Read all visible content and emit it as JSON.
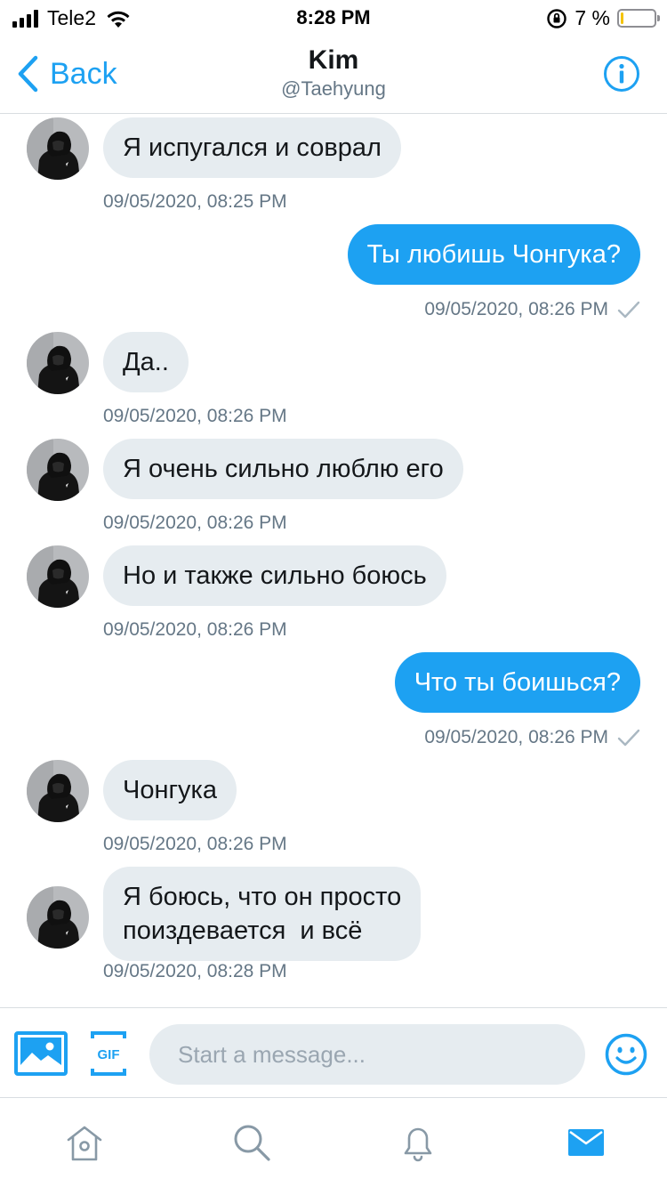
{
  "status_bar": {
    "carrier": "Tele2",
    "time": "8:28 PM",
    "battery_text": "7 %",
    "battery_level": 0.07
  },
  "header": {
    "back_label": "Back",
    "title": "Kim",
    "handle": "@Taehyung"
  },
  "messages": [
    {
      "side": "in",
      "text": "Я испугался и соврал",
      "time": "09/05/2020, 08:25 PM"
    },
    {
      "side": "out",
      "text": "Ты любишь Чонгука?",
      "time": "09/05/2020, 08:26 PM"
    },
    {
      "side": "in",
      "text": "Да..",
      "time": "09/05/2020, 08:26 PM"
    },
    {
      "side": "in",
      "text": "Я очень сильно люблю его",
      "time": "09/05/2020, 08:26 PM"
    },
    {
      "side": "in",
      "text": "Но и также сильно боюсь",
      "time": "09/05/2020, 08:26 PM"
    },
    {
      "side": "out",
      "text": "Что ты боишься?",
      "time": "09/05/2020, 08:26 PM"
    },
    {
      "side": "in",
      "text": "Чонгука",
      "time": "09/05/2020, 08:26 PM"
    },
    {
      "side": "in",
      "text_lines": [
        "Я боюсь, что он просто",
        "поиздевается  и всё"
      ],
      "time": "09/05/2020, 08:28 PM"
    }
  ],
  "composer": {
    "placeholder": "Start a message...",
    "gif_label": "GIF"
  },
  "colors": {
    "accent": "#1da1f2",
    "incoming_bubble": "#e6ecf0",
    "secondary_text": "#657786"
  },
  "tabbar": {
    "items": [
      "home-icon",
      "search-icon",
      "notifications-icon",
      "messages-icon"
    ],
    "active": "messages-icon"
  }
}
